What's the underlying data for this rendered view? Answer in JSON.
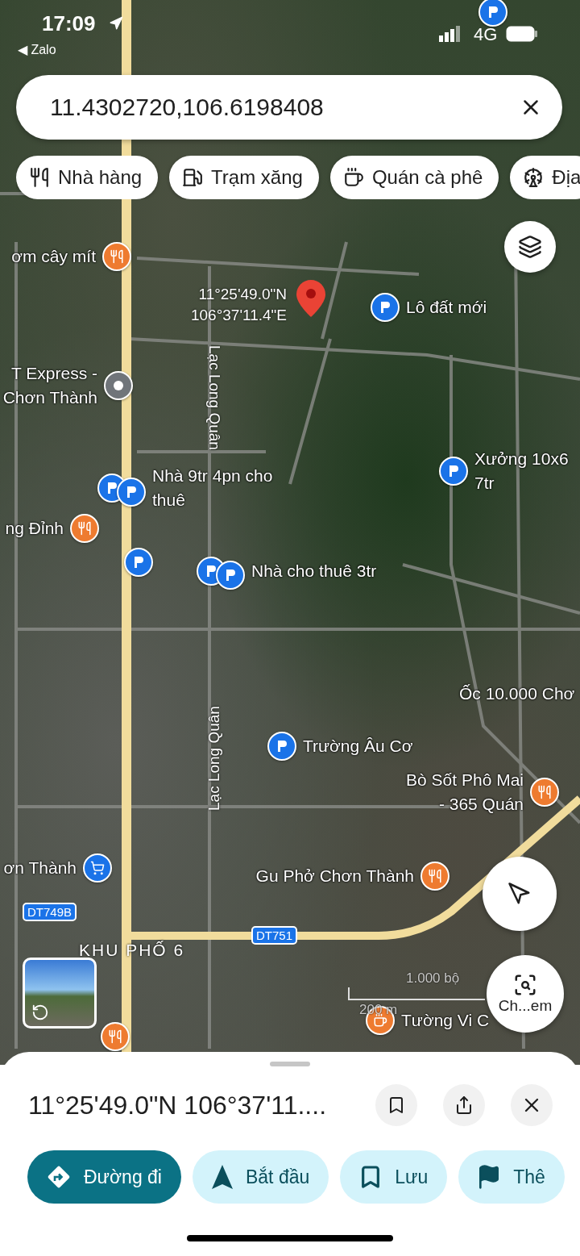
{
  "status_bar": {
    "time": "17:09",
    "back_app": "◀ Zalo",
    "network": "4G"
  },
  "search": {
    "value": "11.4302720,106.6198408"
  },
  "chips": [
    {
      "kind": "restaurant",
      "label": "Nhà hàng"
    },
    {
      "kind": "fuel",
      "label": "Trạm xăng"
    },
    {
      "kind": "cafe",
      "label": "Quán cà phê"
    },
    {
      "kind": "attraction",
      "label": "Địa"
    }
  ],
  "map": {
    "dropped_pin": {
      "lines": [
        "11°25'49.0\"N",
        "106°37'11.4\"E"
      ]
    },
    "places": [
      {
        "pins": [
          {
            "kind": "restaurant"
          }
        ],
        "lines": [
          "ơm cây mít"
        ]
      },
      {
        "pins": [
          {
            "kind": "flag"
          }
        ],
        "lines": [
          "Lô đất mới"
        ]
      },
      {
        "pins": [
          {
            "kind": "place"
          }
        ],
        "lines": [
          "T Express -",
          "Chơn Thành"
        ]
      },
      {
        "pins": [
          {
            "kind": "flag"
          },
          {
            "kind": "flag"
          }
        ],
        "lines": [
          "Nhà 9tr 4pn cho",
          "thuê"
        ]
      },
      {
        "pins": [
          {
            "kind": "flag"
          }
        ],
        "lines": [
          "Xưởng 10x6",
          "7tr"
        ]
      },
      {
        "pins": [
          {
            "kind": "restaurant"
          }
        ],
        "lines": [
          "ng Đỉnh"
        ]
      },
      {
        "pins": [
          {
            "kind": "flag"
          }
        ]
      },
      {
        "pins": [
          {
            "kind": "flag"
          },
          {
            "kind": "flag"
          }
        ],
        "lines": [
          "Nhà cho thuê 3tr"
        ]
      },
      {
        "pins": [
          {
            "kind": "flag"
          }
        ],
        "lines": [
          "Trường Âu Cơ"
        ]
      },
      {
        "pins": [
          {
            "kind": "restaurant"
          }
        ],
        "lines": [
          "Bò Sốt Phô Mai",
          "- 365 Quán"
        ]
      },
      {
        "pins": [
          {
            "kind": "shop"
          }
        ],
        "lines": [
          "ơn Thành"
        ]
      },
      {
        "pins": [
          {
            "kind": "restaurant"
          }
        ],
        "lines": [
          "Gu Phở Chơn Thành"
        ]
      },
      {
        "pins": [
          {
            "kind": "cafe"
          }
        ],
        "lines": [
          "Tường Vi C"
        ]
      },
      {
        "pins": [
          {
            "kind": "restaurant"
          }
        ]
      },
      {
        "pins": [
          {
            "kind": "flag"
          }
        ]
      },
      {
        "lines": [
          "Ốc 10.000 Chơ"
        ]
      }
    ],
    "streets": [
      "Lạc Long Quân",
      "Lạc Long Quân"
    ],
    "road_shields": [
      "DT749B",
      "DT751"
    ],
    "area_label": "KHU PHỐ 6",
    "scale": {
      "imperial": "1.000 bộ",
      "metric": "200 m"
    }
  },
  "camera_search": {
    "label": "Ch...em"
  },
  "sheet": {
    "title": "11°25'49.0\"N 106°37'11....",
    "actions": [
      {
        "kind": "directions",
        "label": "Đường đi",
        "primary": true
      },
      {
        "kind": "start",
        "label": "Bắt đầu",
        "primary": false
      },
      {
        "kind": "save",
        "label": "Lưu",
        "primary": false
      },
      {
        "kind": "more",
        "label": "Thê",
        "primary": false
      }
    ]
  }
}
